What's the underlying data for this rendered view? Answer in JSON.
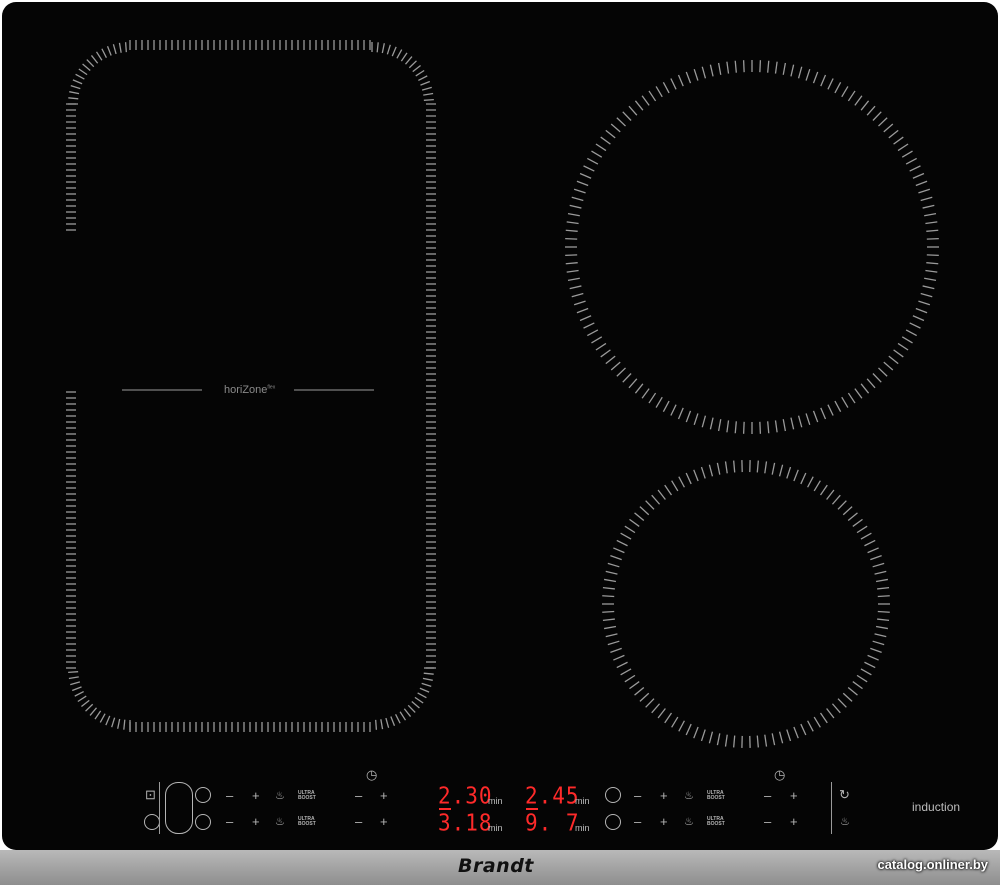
{
  "brand": "Brandt",
  "watermark": "catalog.onliner.by",
  "horizone_label": "horiZone",
  "horizone_sup": "flex",
  "induction_label": "induction",
  "icons": {
    "lock": "lock-icon",
    "power": "power-icon",
    "timer": "timer-icon",
    "pot": "pot-icon",
    "recall": "recall-icon",
    "keep_warm": "keep-warm-icon"
  },
  "controls": {
    "minus": "–",
    "plus": "+",
    "ultra_boost_line1": "ULTRA",
    "ultra_boost_line2": "BOOST"
  },
  "timers": {
    "left_top": "2.30",
    "left_bottom": "3.18",
    "right_top": "2.45",
    "right_bottom": "9. 7",
    "unit": "min"
  },
  "colors": {
    "glass": "#050505",
    "marks": "#9a9a9a",
    "display": "#ff2a2a",
    "strip": "#a5a5a5"
  }
}
